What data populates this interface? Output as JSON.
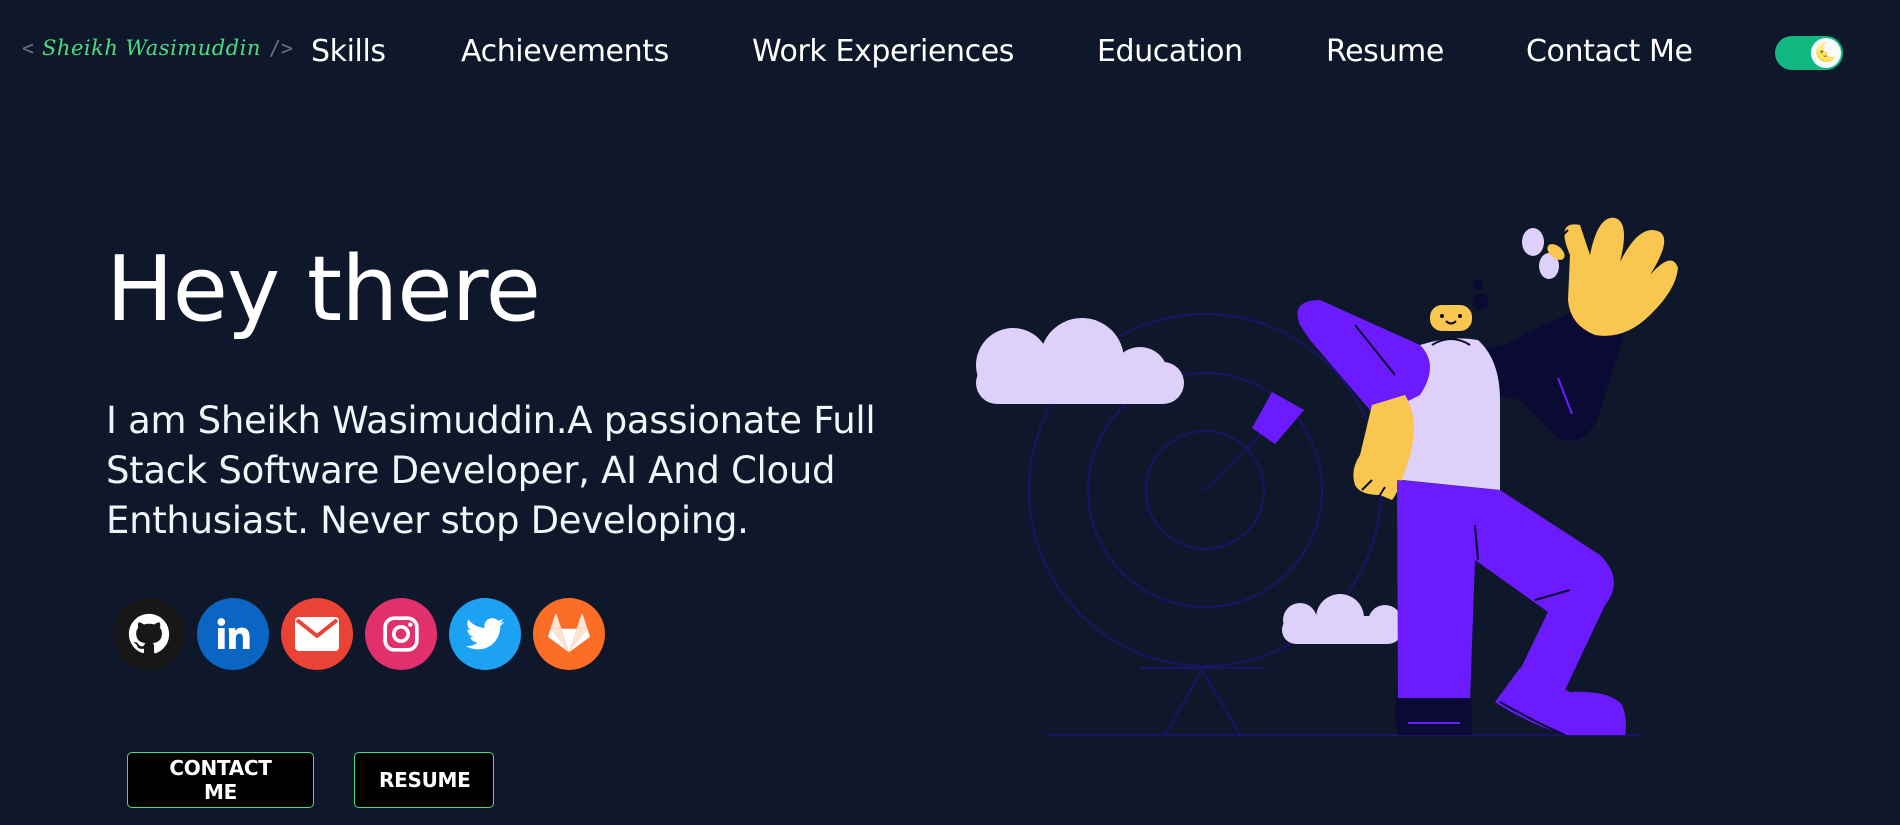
{
  "logo": {
    "open": "<",
    "name": "Sheikh Wasimuddin",
    "close": "/>"
  },
  "nav": {
    "items": [
      {
        "label": "Skills"
      },
      {
        "label": "Achievements"
      },
      {
        "label": "Work Experiences"
      },
      {
        "label": "Education"
      },
      {
        "label": "Resume"
      },
      {
        "label": "Contact Me"
      }
    ],
    "theme_toggle": {
      "icon": "moon-face-emoji",
      "glyph": "🌜",
      "color": "#10b981"
    }
  },
  "hero": {
    "title": "Hey there",
    "subtitle": "I am Sheikh Wasimuddin.A passionate Full Stack Software Developer, AI And Cloud Enthusiast. Never stop Developing."
  },
  "social": [
    {
      "name": "github-icon",
      "color": "#181717"
    },
    {
      "name": "linkedin-icon",
      "color": "#0a66c2"
    },
    {
      "name": "mail-icon",
      "color": "#ea4335"
    },
    {
      "name": "instagram-icon",
      "color": "#e1306c"
    },
    {
      "name": "twitter-icon",
      "color": "#1da1f2"
    },
    {
      "name": "gitlab-icon",
      "color": "#fc6d26"
    }
  ],
  "buttons": {
    "contact": "CONTACT ME",
    "resume": "RESUME"
  },
  "colors": {
    "background": "#0f172a",
    "accent": "#4ade80",
    "purple": "#6c1bff",
    "lavender": "#ddd1fb",
    "yellow": "#f9c74f"
  }
}
